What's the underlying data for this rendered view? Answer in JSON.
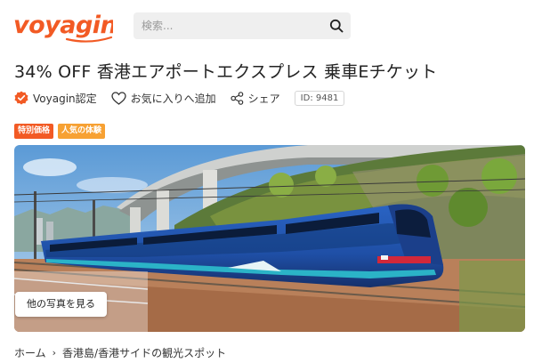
{
  "brand": {
    "logo_text": "voyagin",
    "color": "#f25a24"
  },
  "search": {
    "placeholder": "検索...",
    "icon": "search-icon"
  },
  "product": {
    "title": "34% OFF 香港エアポートエクスプレス 乗車Eチケット",
    "verified_label": "Voyagin認定",
    "favorite_label": "お気に入りへ追加",
    "share_label": "シェア",
    "id_label": "ID: 9481"
  },
  "tags": [
    {
      "label": "特別価格",
      "color": "#f25a24"
    },
    {
      "label": "人気の体験",
      "color": "#f7a133"
    }
  ],
  "gallery": {
    "more_photos_label": "他の写真を見る"
  },
  "breadcrumb": {
    "home": "ホーム",
    "separator": "›",
    "current": "香港島/香港サイドの観光スポット"
  }
}
